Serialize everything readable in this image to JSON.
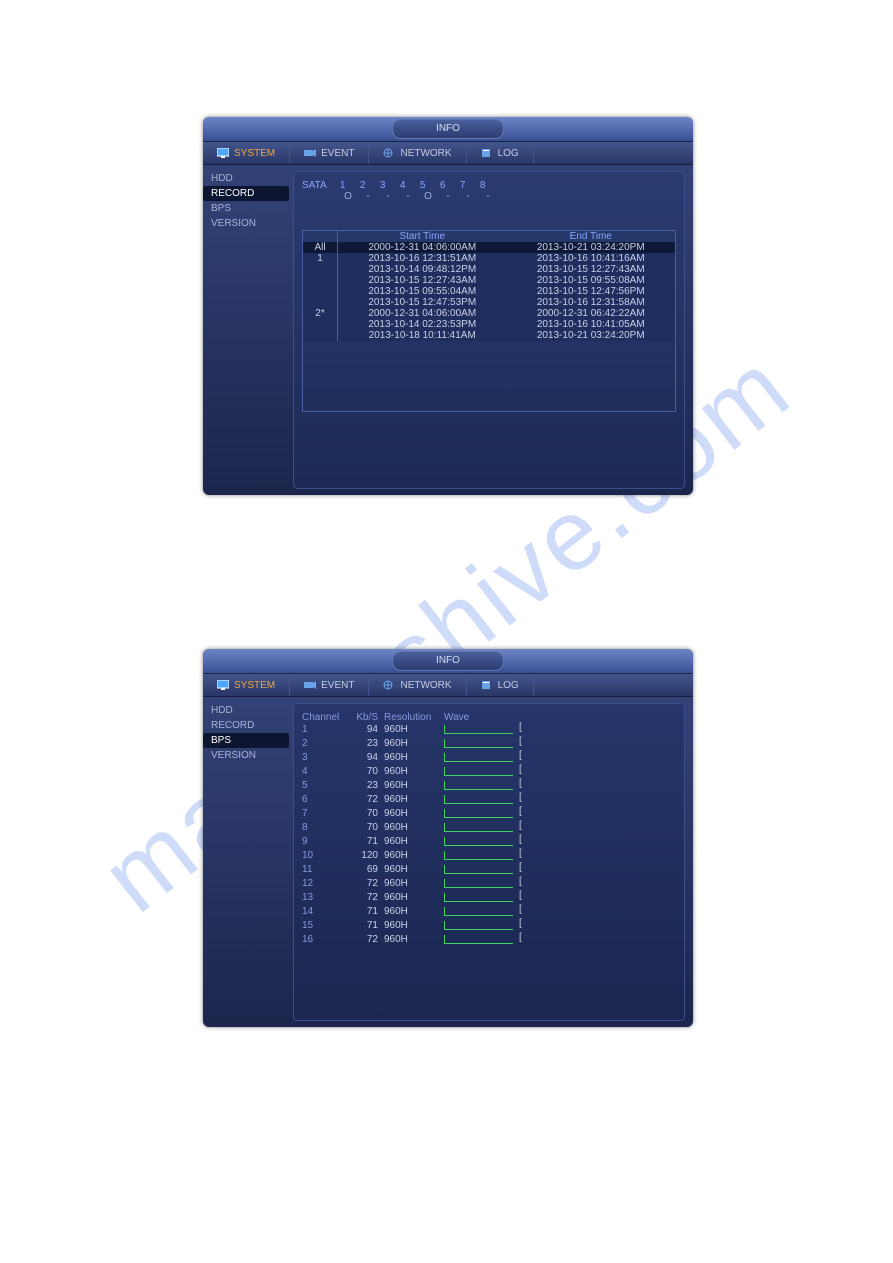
{
  "watermark": "manualshive.com",
  "window1": {
    "title": "INFO",
    "tabs": [
      {
        "label": "SYSTEM",
        "active": true
      },
      {
        "label": "EVENT"
      },
      {
        "label": "NETWORK"
      },
      {
        "label": "LOG"
      }
    ],
    "sidebar": [
      {
        "label": "HDD"
      },
      {
        "label": "RECORD",
        "active": true
      },
      {
        "label": "BPS"
      },
      {
        "label": "VERSION"
      }
    ],
    "sata": {
      "label": "SATA",
      "numbers": [
        "1",
        "2",
        "3",
        "4",
        "5",
        "6",
        "7",
        "8"
      ],
      "status": [
        "O",
        "-",
        "-",
        "-",
        "O",
        "-",
        "-",
        "-"
      ]
    },
    "record_table": {
      "headers": [
        "",
        "Start Time",
        "End Time"
      ],
      "rows": [
        {
          "id": "All",
          "start": "2000-12-31 04:06:00AM",
          "end": "2013-10-21 03:24:20PM",
          "selected": true
        },
        {
          "id": "1",
          "start": "2013-10-16 12:31:51AM",
          "end": "2013-10-16 10:41:16AM"
        },
        {
          "id": "",
          "start": "2013-10-14 09:48:12PM",
          "end": "2013-10-15 12:27:43AM"
        },
        {
          "id": "",
          "start": "2013-10-15 12:27:43AM",
          "end": "2013-10-15 09:55:08AM"
        },
        {
          "id": "",
          "start": "2013-10-15 09:55:04AM",
          "end": "2013-10-15 12:47:56PM"
        },
        {
          "id": "",
          "start": "2013-10-15 12:47:53PM",
          "end": "2013-10-16 12:31:58AM"
        },
        {
          "id": "2*",
          "start": "2000-12-31 04:06:00AM",
          "end": "2000-12-31 06:42:22AM"
        },
        {
          "id": "",
          "start": "2013-10-14 02:23:53PM",
          "end": "2013-10-16 10:41:05AM"
        },
        {
          "id": "",
          "start": "2013-10-18 10:11:41AM",
          "end": "2013-10-21 03:24:20PM"
        }
      ]
    }
  },
  "window2": {
    "title": "INFO",
    "tabs": [
      {
        "label": "SYSTEM",
        "active": true
      },
      {
        "label": "EVENT"
      },
      {
        "label": "NETWORK"
      },
      {
        "label": "LOG"
      }
    ],
    "sidebar": [
      {
        "label": "HDD"
      },
      {
        "label": "RECORD"
      },
      {
        "label": "BPS",
        "active": true
      },
      {
        "label": "VERSION"
      }
    ],
    "bps_table": {
      "headers": {
        "channel": "Channel",
        "kbs": "Kb/S",
        "resolution": "Resolution",
        "wave": "Wave"
      },
      "rows": [
        {
          "ch": "1",
          "kb": "94",
          "res": "960H"
        },
        {
          "ch": "2",
          "kb": "23",
          "res": "960H"
        },
        {
          "ch": "3",
          "kb": "94",
          "res": "960H"
        },
        {
          "ch": "4",
          "kb": "70",
          "res": "960H"
        },
        {
          "ch": "5",
          "kb": "23",
          "res": "960H"
        },
        {
          "ch": "6",
          "kb": "72",
          "res": "960H"
        },
        {
          "ch": "7",
          "kb": "70",
          "res": "960H"
        },
        {
          "ch": "8",
          "kb": "70",
          "res": "960H"
        },
        {
          "ch": "9",
          "kb": "71",
          "res": "960H"
        },
        {
          "ch": "10",
          "kb": "120",
          "res": "960H"
        },
        {
          "ch": "11",
          "kb": "69",
          "res": "960H"
        },
        {
          "ch": "12",
          "kb": "72",
          "res": "960H"
        },
        {
          "ch": "13",
          "kb": "72",
          "res": "960H"
        },
        {
          "ch": "14",
          "kb": "71",
          "res": "960H"
        },
        {
          "ch": "15",
          "kb": "71",
          "res": "960H"
        },
        {
          "ch": "16",
          "kb": "72",
          "res": "960H"
        }
      ]
    }
  }
}
